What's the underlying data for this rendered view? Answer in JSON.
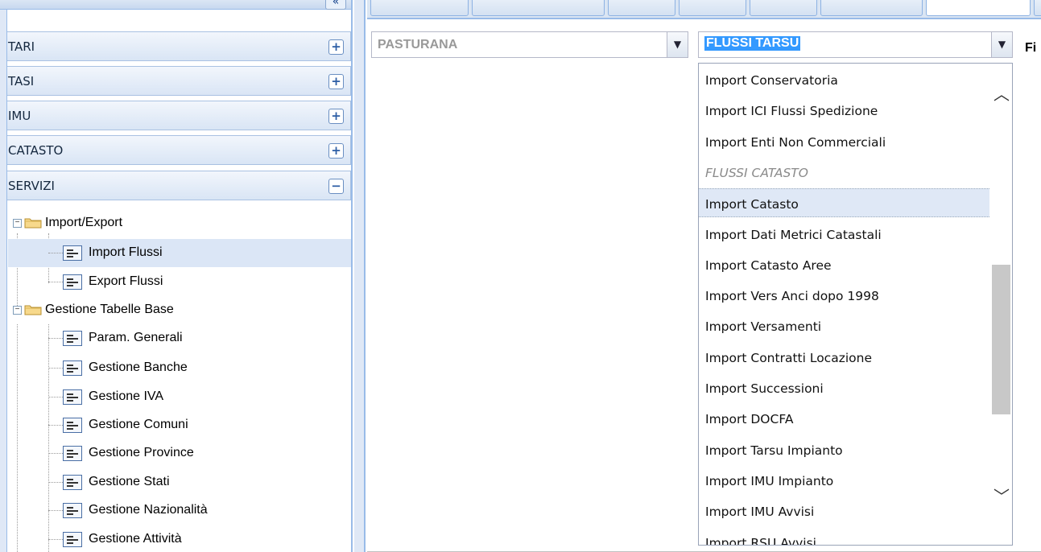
{
  "left_panel": {
    "collapse_label": "«",
    "accordion": [
      {
        "label": "TARI",
        "tool": "+"
      },
      {
        "label": "TASI",
        "tool": "+"
      },
      {
        "label": "IMU",
        "tool": "+"
      },
      {
        "label": "CATASTO",
        "tool": "+"
      },
      {
        "label": "SERVIZI",
        "tool": "−"
      }
    ],
    "tree": [
      {
        "label": "Import/Export",
        "type": "folder"
      },
      {
        "label": "Import Flussi",
        "type": "leaf",
        "selected": true
      },
      {
        "label": "Export Flussi",
        "type": "leaf"
      },
      {
        "label": "Gestione Tabelle Base",
        "type": "folder"
      },
      {
        "label": "Param. Generali",
        "type": "leaf"
      },
      {
        "label": "Gestione Banche",
        "type": "leaf"
      },
      {
        "label": "Gestione IVA",
        "type": "leaf"
      },
      {
        "label": "Gestione Comuni",
        "type": "leaf"
      },
      {
        "label": "Gestione Province",
        "type": "leaf"
      },
      {
        "label": "Gestione Stati",
        "type": "leaf"
      },
      {
        "label": "Gestione Nazionalità",
        "type": "leaf"
      },
      {
        "label": "Gestione Attività",
        "type": "leaf"
      }
    ]
  },
  "toolbar": {
    "comune_value": "PASTURANA",
    "flussi_value": "FLUSSI TARSU",
    "filter_label": "Fi"
  },
  "dropdown": {
    "items": [
      {
        "label": "Import Conservatoria"
      },
      {
        "label": "Import ICI Flussi Spedizione"
      },
      {
        "label": "Import Enti Non Commerciali"
      },
      {
        "label": "FLUSSI CATASTO",
        "group": true
      },
      {
        "label": "Import Catasto",
        "hover": true
      },
      {
        "label": "Import Dati Metrici Catastali"
      },
      {
        "label": "Import Catasto Aree"
      },
      {
        "label": "Import Vers Anci dopo 1998"
      },
      {
        "label": "Import Versamenti"
      },
      {
        "label": "Import Contratti Locazione"
      },
      {
        "label": "Import Successioni"
      },
      {
        "label": "Import DOCFA"
      },
      {
        "label": "Import Tarsu Impianto"
      },
      {
        "label": "Import IMU Impianto"
      },
      {
        "label": "Import IMU Avvisi"
      },
      {
        "label": "Import RSU Avvisi"
      }
    ]
  },
  "colors": {
    "accent": "#99bbe8",
    "selection": "#3399ff",
    "hover": "#dfe8f6"
  }
}
